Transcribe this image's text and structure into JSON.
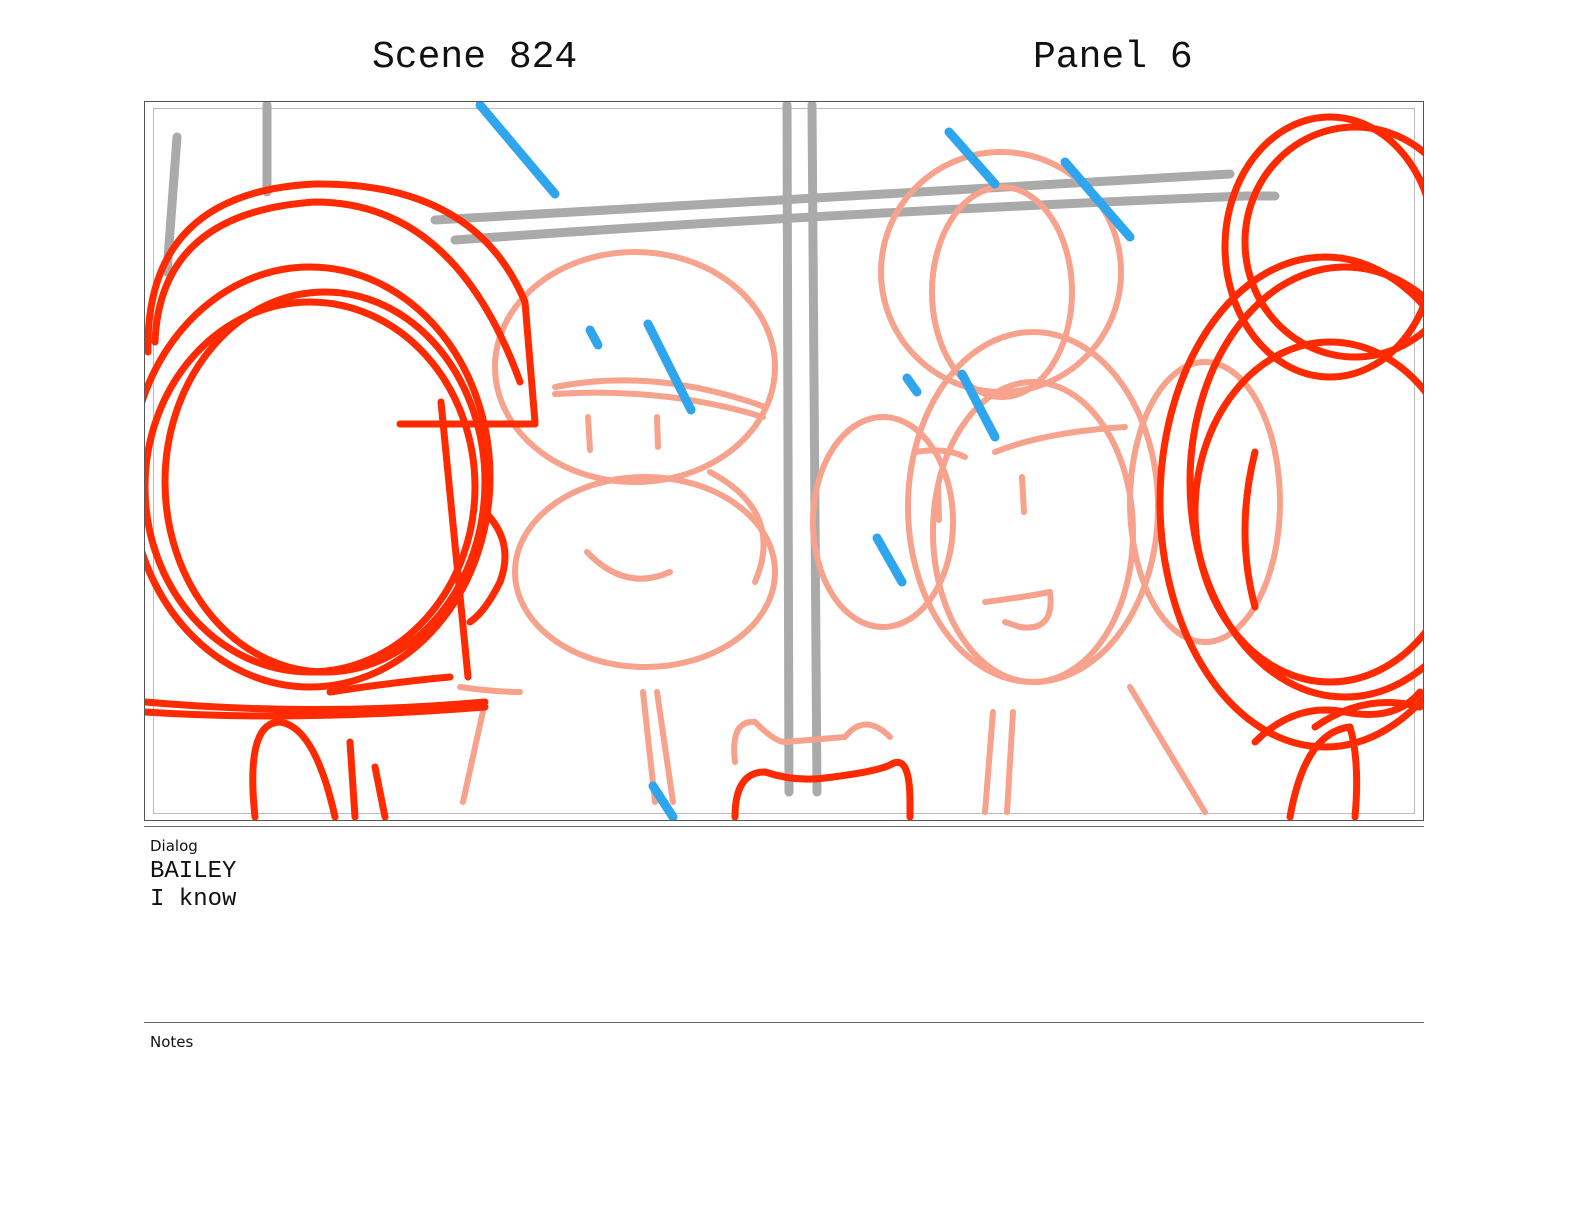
{
  "header": {
    "scene": "Scene 824",
    "panel": "Panel 6"
  },
  "panel_image": {
    "colors": {
      "red": "#ff2a00",
      "pink": "#f7a28c",
      "gray": "#aaaaaa",
      "blue": "#2fa5ee"
    }
  },
  "dialog": {
    "label": "Dialog",
    "character": "BAILEY",
    "line": "I know"
  },
  "notes": {
    "label": "Notes"
  }
}
